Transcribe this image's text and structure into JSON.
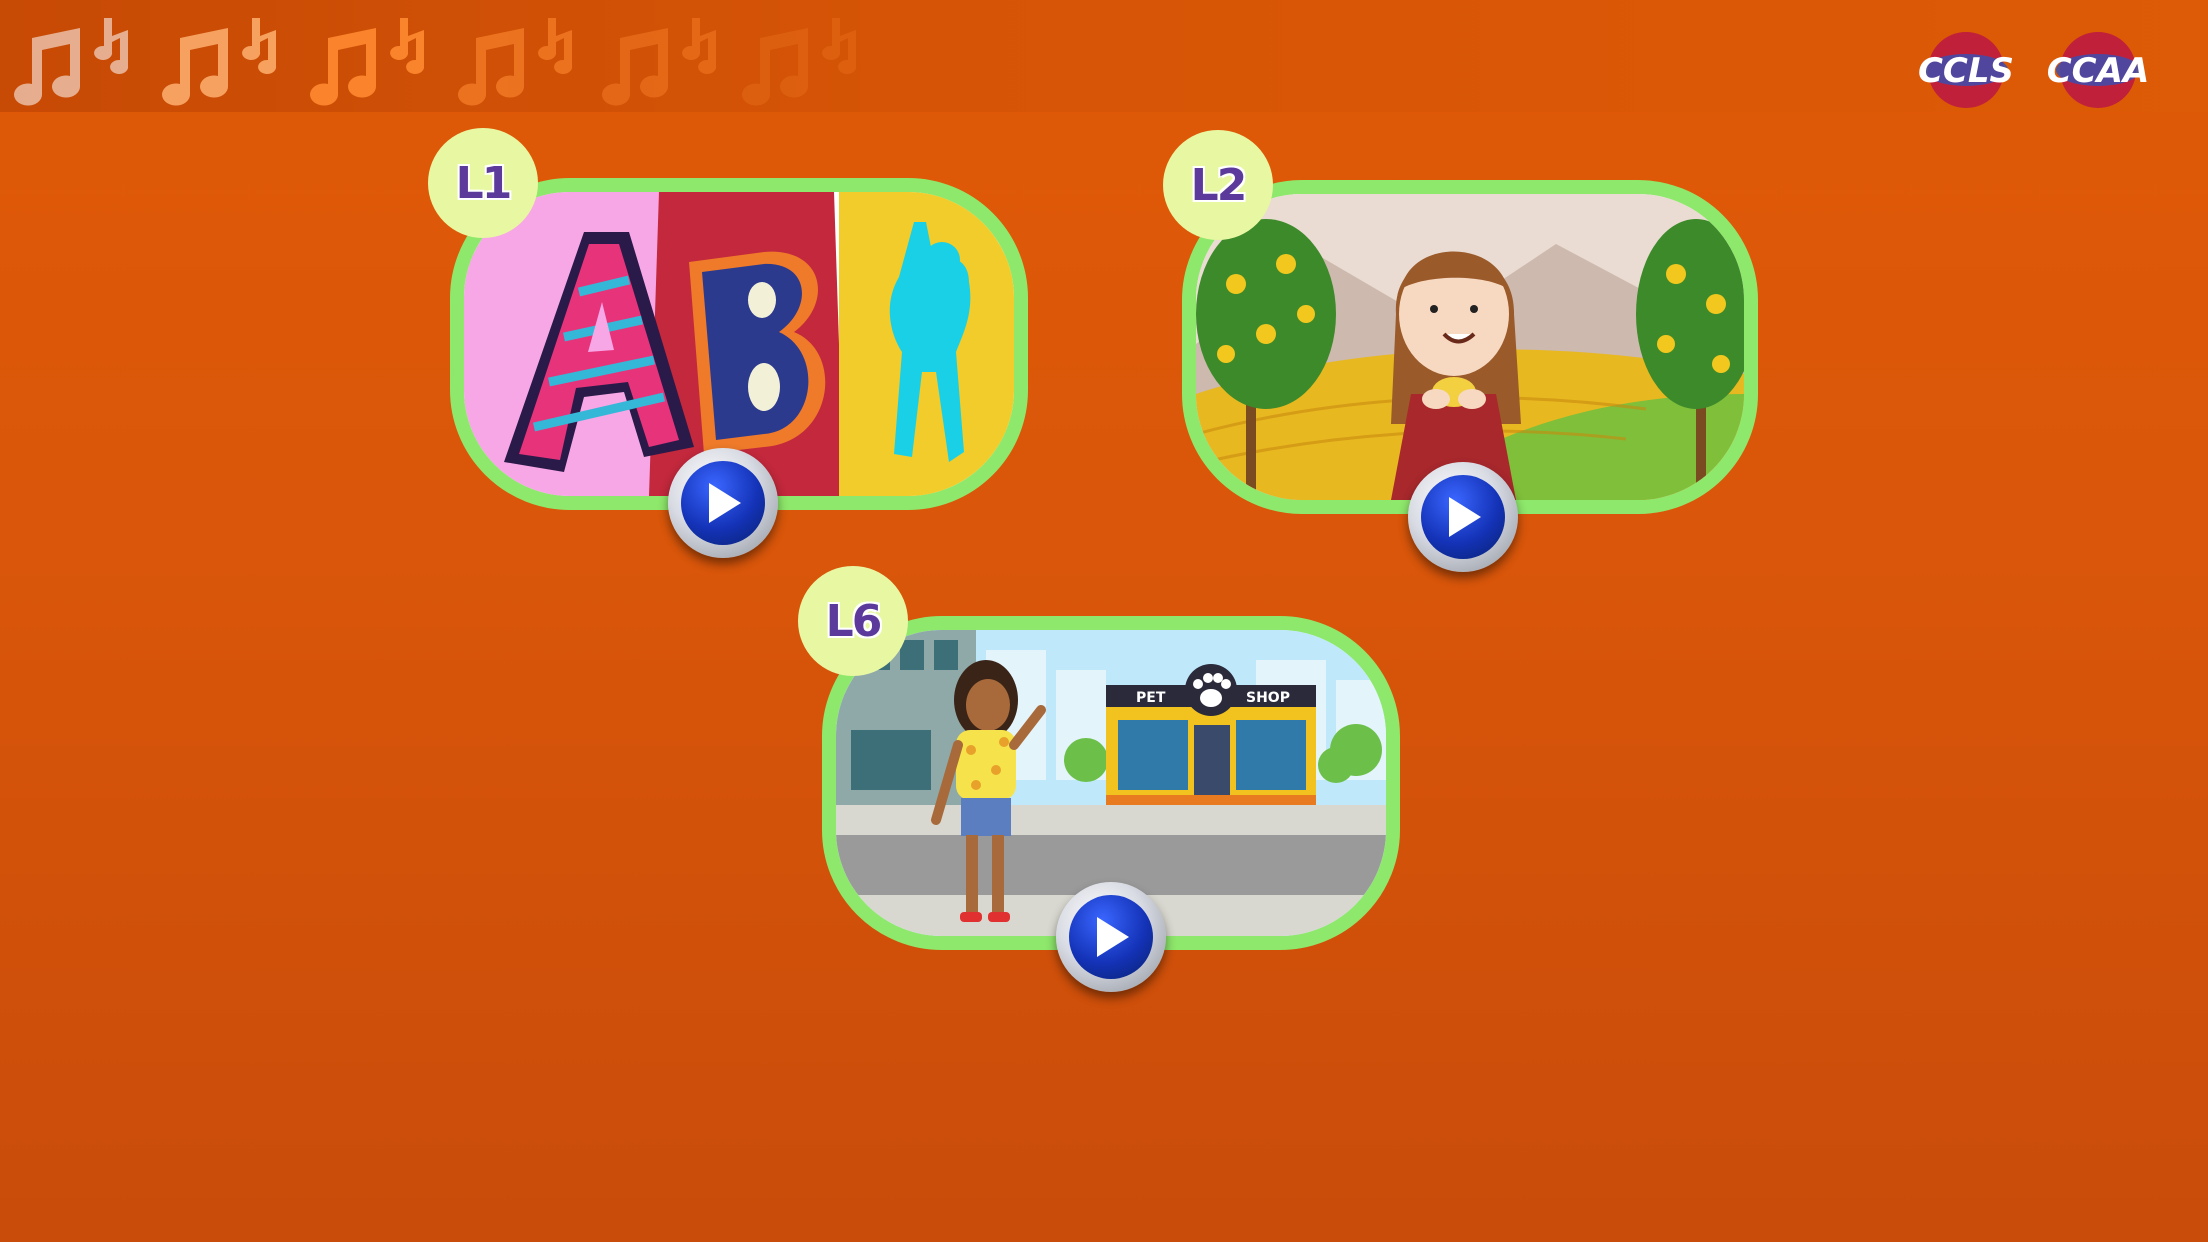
{
  "header": {
    "music_notes_icon": "music-notes-icon",
    "logos": [
      "CCLS",
      "CCAA"
    ]
  },
  "lessons": [
    {
      "badge": "L1",
      "thumbnail": "alphabet-AB-dance"
    },
    {
      "badge": "L2",
      "thumbnail": "girl-lemon-grove"
    },
    {
      "badge": "L6",
      "thumbnail": "girl-pet-shop-street"
    }
  ],
  "colors": {
    "background": "#d9560a",
    "card_border": "#8ee86b",
    "badge_bg": "#e8f7a2",
    "badge_text": "#5b3a9c",
    "play_blue": "#1433b8"
  }
}
